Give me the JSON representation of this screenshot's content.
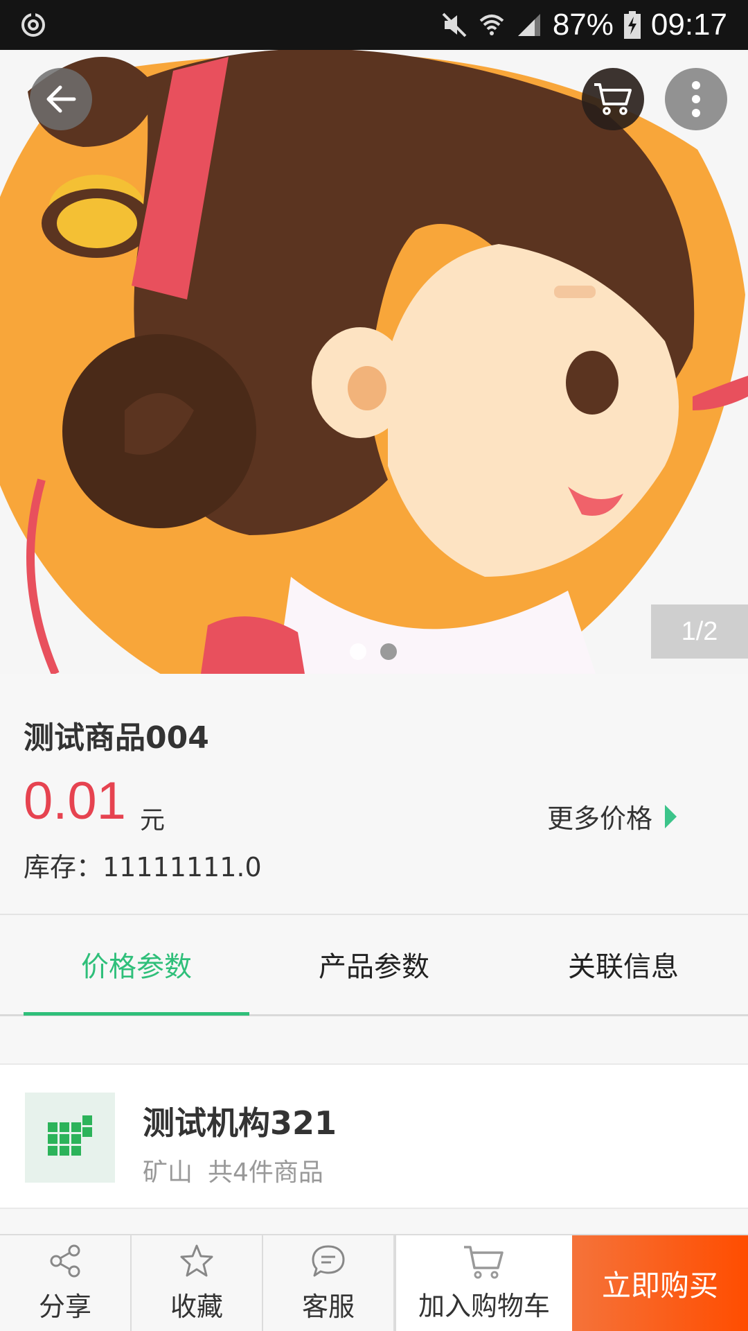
{
  "status_bar": {
    "battery": "87%",
    "time": "09:17",
    "icons": [
      "sync-icon",
      "mute-icon",
      "wifi-icon",
      "signal-icon",
      "battery-charging-icon"
    ]
  },
  "gallery": {
    "page_counter": "1/2",
    "current_index": 1,
    "total": 2
  },
  "product": {
    "title": "测试商品004",
    "price": "0.01",
    "unit": "元",
    "more_price_label": "更多价格",
    "stock": "库存：11111111.0"
  },
  "tabs": [
    {
      "label": "价格参数",
      "active": true
    },
    {
      "label": "产品参数",
      "active": false
    },
    {
      "label": "关联信息",
      "active": false
    }
  ],
  "store": {
    "name": "测试机构321",
    "region": "矿山",
    "count": "共4件商品"
  },
  "bottom_bar": {
    "share": "分享",
    "favorite": "收藏",
    "service": "客服",
    "add_to_cart": "加入购物车",
    "buy_now": "立即购买"
  },
  "colors": {
    "accent_green": "#2fbf7a",
    "price_red": "#e64350",
    "buy_orange": "#ff4d00"
  }
}
